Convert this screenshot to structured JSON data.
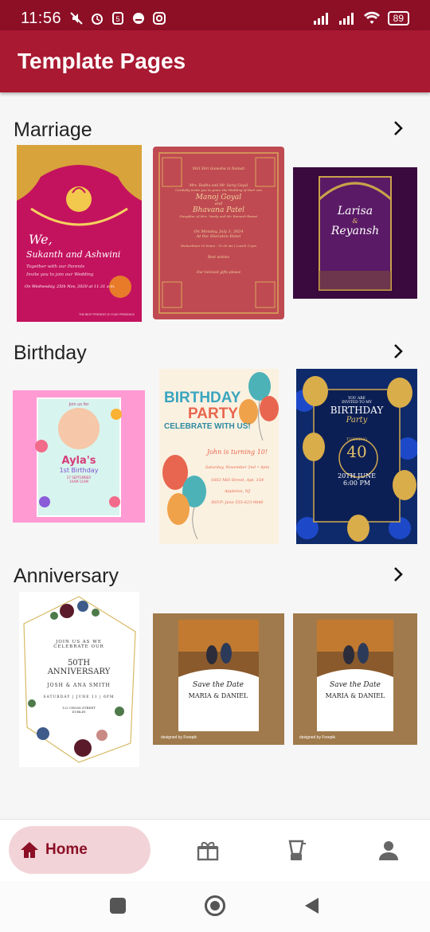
{
  "status_bar": {
    "time": "11:56",
    "battery": "89"
  },
  "app_bar": {
    "title": "Template Pages"
  },
  "sections": [
    {
      "title": "Marriage",
      "cards": [
        {
          "name": "Ganesha wedding invitation",
          "lines": [
            "We,",
            "Sukanth and Ashwini",
            "Together with our Parents",
            "Invite you to join our Wedding",
            "On Wednesday, 25th Nov, 2020 at 11.31 a.m.",
            "THE BEST PRESENT IS YOUR PRESENCE"
          ]
        },
        {
          "name": "Red wedding invitation",
          "lines": [
            "Shri Shri Ganesha in Namah",
            "Mrs. Radha and Mr. Suraj Goyal",
            "Cordially invite you to grace the Wedding of their son",
            "Manoj Goyal",
            "and",
            "Bhavana Patel",
            "Daughter of Mrs. Vandy and Mr. Ramesh Rawat",
            "On Monday, July 3, 2024",
            "At the Sheraton Hotel",
            "Muhurtham 10:00am - 11:00 am | Lunch 12pm",
            "Best wishes",
            "Our beloved gifts please"
          ]
        },
        {
          "name": "Purple wedding invitation",
          "lines": [
            "Larisa",
            "&",
            "Reyansh"
          ]
        }
      ]
    },
    {
      "title": "Birthday",
      "cards": [
        {
          "name": "Ayla first birthday",
          "lines": [
            "Join us for",
            "Ayla's",
            "1st Birthday",
            "27 SEPTEMBER",
            "10AM-11AM"
          ]
        },
        {
          "name": "Birthday party balloons",
          "lines": [
            "BIRTHDAY",
            "PARTY",
            "CELEBRATE WITH US!",
            "John is turning 10!",
            "Saturday, November 2nd • 4pm",
            "1602 Mill Street, Apt. 154",
            "Appleton, NJ",
            "RSVP: Jane 555-623-9846"
          ]
        },
        {
          "name": "Blue birthday turning 40",
          "lines": [
            "YOU ARE",
            "INVITED TO MY",
            "BIRTHDAY",
            "Party",
            "TURNING",
            "40",
            "20TH JUNE",
            "6:00 PM"
          ]
        }
      ]
    },
    {
      "title": "Anniversary",
      "cards": [
        {
          "name": "Floral 50th anniversary",
          "lines": [
            "JOIN US AS WE",
            "CELEBRATE OUR",
            "50TH",
            "ANNIVERSARY",
            "JOSH & ANA SMITH",
            "SATURDAY | JUNE 11 | 6PM",
            "123 CROSS STREET",
            "DUBLIN"
          ]
        },
        {
          "name": "Save the date photo",
          "lines": [
            "Save the Date",
            "MARIA & DANIEL",
            "designed by Freepik"
          ]
        },
        {
          "name": "Save the date photo copy",
          "lines": [
            "Save the Date",
            "MARIA & DANIEL",
            "designed by Freepik"
          ]
        }
      ]
    }
  ],
  "bottom_nav": {
    "home_label": "Home",
    "items": [
      "home-icon",
      "gift-icon",
      "blender-icon",
      "person-icon"
    ]
  },
  "colors": {
    "primary": "#a91931",
    "status": "#8c0f26",
    "pill": "#f2d4d8"
  }
}
